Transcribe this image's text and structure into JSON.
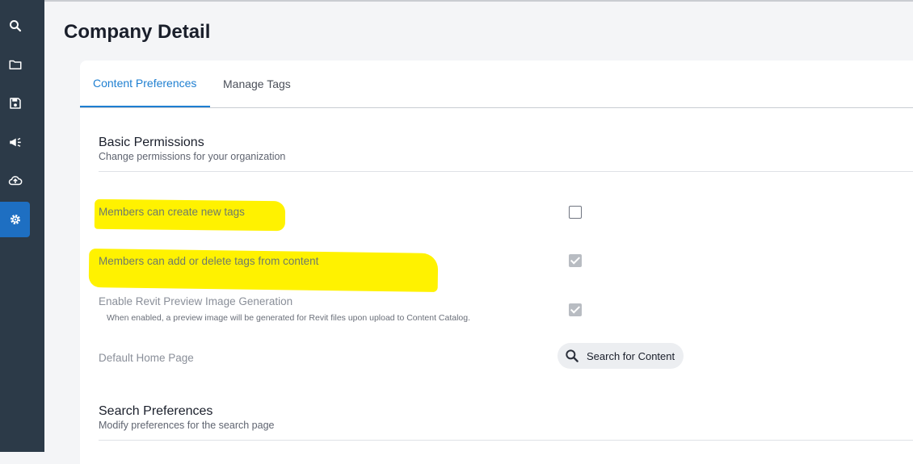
{
  "page": {
    "title": "Company Detail"
  },
  "sidebar": {
    "items": [
      {
        "icon": "search-icon",
        "active": false
      },
      {
        "icon": "folder-icon",
        "active": false
      },
      {
        "icon": "save-icon",
        "active": false
      },
      {
        "icon": "megaphone-icon",
        "active": false
      },
      {
        "icon": "cloud-upload-icon",
        "active": false
      },
      {
        "icon": "gear-icon",
        "active": true
      }
    ],
    "active_color": "#1e6fc2",
    "background": "#2c3a48"
  },
  "tabs": [
    {
      "label": "Content Preferences",
      "active": true
    },
    {
      "label": "Manage Tags",
      "active": false
    }
  ],
  "basic_permissions": {
    "title": "Basic Permissions",
    "subtitle": "Change permissions for your organization",
    "rows": [
      {
        "label": "Members can create new tags",
        "checked": false,
        "highlighted": true
      },
      {
        "label": "Members can add or delete tags from content",
        "checked": true,
        "highlighted": true
      },
      {
        "label": "Enable Revit Preview Image Generation",
        "description": "When enabled, a preview image will be generated for Revit files upon upload to Content Catalog.",
        "checked": true,
        "highlighted": false
      }
    ],
    "default_home_page": {
      "label": "Default Home Page",
      "value": "Search for Content",
      "icon": "search-icon"
    }
  },
  "search_preferences": {
    "title": "Search Preferences",
    "subtitle": "Modify preferences for the search page"
  },
  "colors": {
    "accent": "#1e7fd1",
    "highlight": "#fff200"
  }
}
